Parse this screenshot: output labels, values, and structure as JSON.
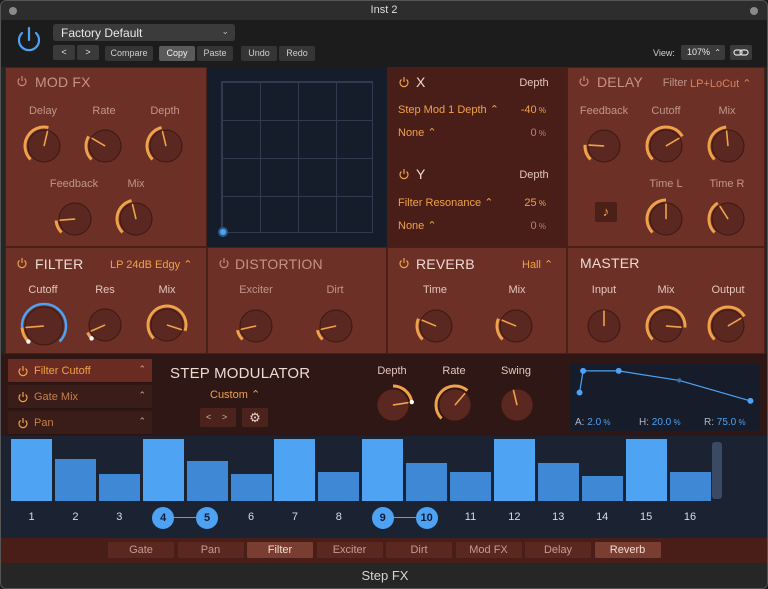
{
  "window": {
    "title": "Inst 2",
    "footer_title": "Step FX"
  },
  "header": {
    "preset": "Factory Default",
    "compare": "Compare",
    "copy": "Copy",
    "paste": "Paste",
    "undo": "Undo",
    "redo": "Redo",
    "view_label": "View:",
    "view_value": "107%"
  },
  "modfx": {
    "title": "MOD FX",
    "delay": "Delay",
    "rate": "Rate",
    "depth": "Depth",
    "feedback": "Feedback",
    "mix": "Mix"
  },
  "xmod": {
    "title": "X",
    "depth_label": "Depth",
    "target1": "Step Mod 1 Depth",
    "value1": "-40",
    "target2": "None",
    "value2": "0",
    "unit": "%"
  },
  "ymod": {
    "title": "Y",
    "depth_label": "Depth",
    "target1": "Filter Resonance",
    "value1": "25",
    "target2": "None",
    "value2": "0",
    "unit": "%"
  },
  "delay": {
    "title": "DELAY",
    "filter_label": "Filter",
    "filter_value": "LP+LoCut",
    "feedback": "Feedback",
    "cutoff": "Cutoff",
    "mix": "Mix",
    "time_l": "Time L",
    "time_r": "Time R"
  },
  "filter": {
    "title": "FILTER",
    "mode": "LP 24dB Edgy",
    "cutoff": "Cutoff",
    "res": "Res",
    "mix": "Mix"
  },
  "distortion": {
    "title": "DISTORTION",
    "exciter": "Exciter",
    "dirt": "Dirt"
  },
  "reverb": {
    "title": "REVERB",
    "mode": "Hall",
    "time": "Time",
    "mix": "Mix"
  },
  "master": {
    "title": "MASTER",
    "input": "Input",
    "mix": "Mix",
    "output": "Output"
  },
  "stepmod": {
    "slots": [
      {
        "label": "Filter Cutoff"
      },
      {
        "label": "Gate Mix"
      },
      {
        "label": "Pan"
      }
    ],
    "title": "STEP MODULATOR",
    "pattern": "Custom",
    "depth": "Depth",
    "rate": "Rate",
    "swing": "Swing"
  },
  "envelope": {
    "a_label": "A:",
    "a_value": "2.0",
    "h_label": "H:",
    "h_value": "20.0",
    "r_label": "R:",
    "r_value": "75.0",
    "unit": "%",
    "points": [
      [
        0.02,
        0.62
      ],
      [
        0.04,
        0.05
      ],
      [
        0.24,
        0.05
      ],
      [
        0.58,
        0.3
      ],
      [
        0.98,
        0.84
      ]
    ]
  },
  "steps": {
    "values": [
      1.0,
      0.68,
      0.44,
      1.0,
      0.64,
      0.43,
      1.0,
      0.47,
      1.0,
      0.62,
      0.46,
      1.0,
      0.62,
      0.4,
      1.0,
      0.46
    ],
    "labels": [
      "1",
      "2",
      "3",
      "4",
      "5",
      "6",
      "7",
      "8",
      "9",
      "10",
      "11",
      "12",
      "13",
      "14",
      "15",
      "16"
    ],
    "highlight": [
      1,
      4,
      7,
      9,
      12,
      15
    ],
    "selected": [
      4,
      5,
      9,
      10
    ]
  },
  "tabs": [
    {
      "label": "Gate"
    },
    {
      "label": "Pan"
    },
    {
      "label": "Filter"
    },
    {
      "label": "Exciter"
    },
    {
      "label": "Dirt"
    },
    {
      "label": "Mod FX"
    },
    {
      "label": "Delay"
    },
    {
      "label": "Reverb"
    }
  ],
  "colors": {
    "accent": "#f0a24a",
    "blue": "#4ea2f3",
    "panel": "#6c3027"
  }
}
